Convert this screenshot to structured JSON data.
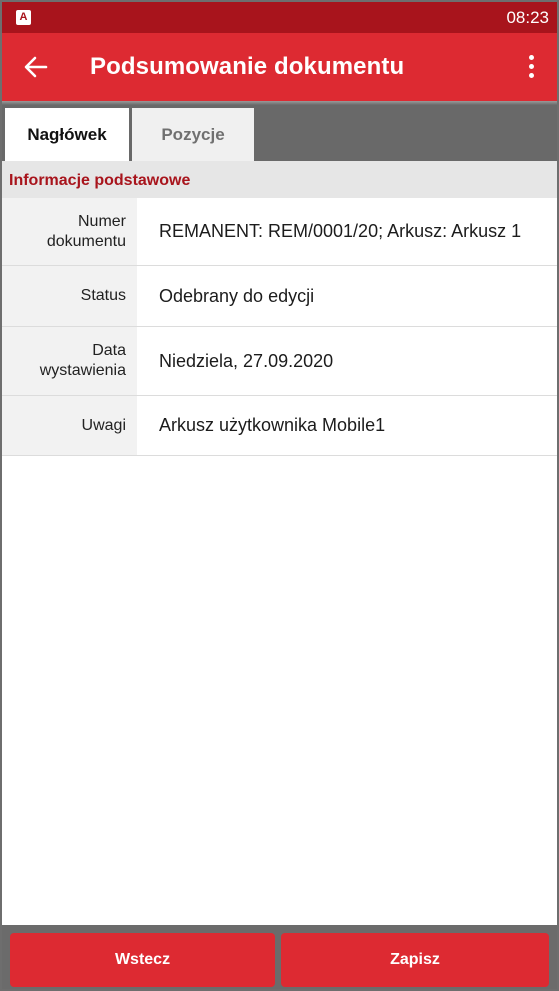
{
  "status_bar": {
    "app_icon_letter": "A",
    "time": "08:23"
  },
  "app_bar": {
    "title": "Podsumowanie dokumentu"
  },
  "tabs": [
    {
      "label": "Nagłówek",
      "active": true
    },
    {
      "label": "Pozycje",
      "active": false
    }
  ],
  "section": {
    "title": "Informacje podstawowe"
  },
  "fields": {
    "number": {
      "label": "Numer dokumentu",
      "value": "REMANENT: REM/0001/20; Arkusz: Arkusz 1"
    },
    "status": {
      "label": "Status",
      "value": "Odebrany do edycji"
    },
    "date": {
      "label": "Data wystawienia",
      "value": "Niedziela, 27.09.2020"
    },
    "notes": {
      "label": "Uwagi",
      "value": "Arkusz użytkownika Mobile1"
    }
  },
  "footer": {
    "back_label": "Wstecz",
    "save_label": "Zapisz"
  },
  "colors": {
    "primary": "#dd2a32",
    "primary_dark": "#a8141c",
    "section_text": "#a8141c"
  }
}
